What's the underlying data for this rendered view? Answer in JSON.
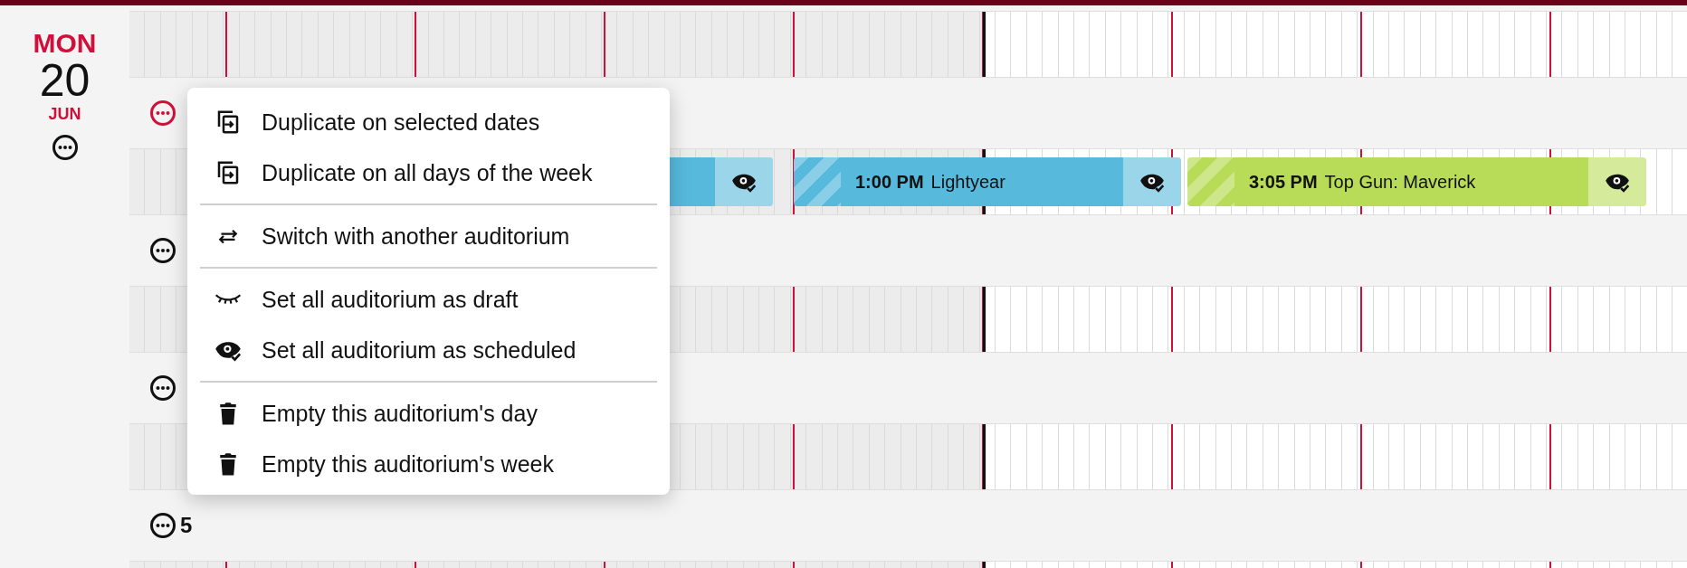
{
  "date": {
    "weekday": "MON",
    "day": "20",
    "month": "JUN"
  },
  "rows": [
    {
      "kind": "grid"
    },
    {
      "kind": "header",
      "menu_open": true
    },
    {
      "kind": "grid",
      "events": [
        {
          "color": "#57b9dc"
        },
        {
          "time": "1:00 PM",
          "title": "Lightyear",
          "color": "#57b9dc"
        },
        {
          "time": "3:05 PM",
          "title": "Top Gun: Maverick",
          "color": "#b9dc58"
        }
      ]
    },
    {
      "kind": "header",
      "menu_open": false
    },
    {
      "kind": "grid"
    },
    {
      "kind": "header",
      "menu_open": false
    },
    {
      "kind": "grid"
    },
    {
      "kind": "header",
      "menu_open": false,
      "label": "5"
    },
    {
      "kind": "grid"
    }
  ],
  "menu": {
    "groups": [
      [
        {
          "kind": "duplicate",
          "label": "Duplicate on selected dates"
        },
        {
          "kind": "duplicate",
          "label": "Duplicate on all days of the week"
        }
      ],
      [
        {
          "kind": "switch",
          "label": "Switch with another auditorium"
        }
      ],
      [
        {
          "kind": "draft",
          "label": "Set all auditorium as draft"
        },
        {
          "kind": "scheduled",
          "label": "Set all auditorium as scheduled"
        }
      ],
      [
        {
          "kind": "delete",
          "label": "Empty this auditorium's day"
        },
        {
          "kind": "delete",
          "label": "Empty this auditorium's week"
        }
      ]
    ]
  }
}
